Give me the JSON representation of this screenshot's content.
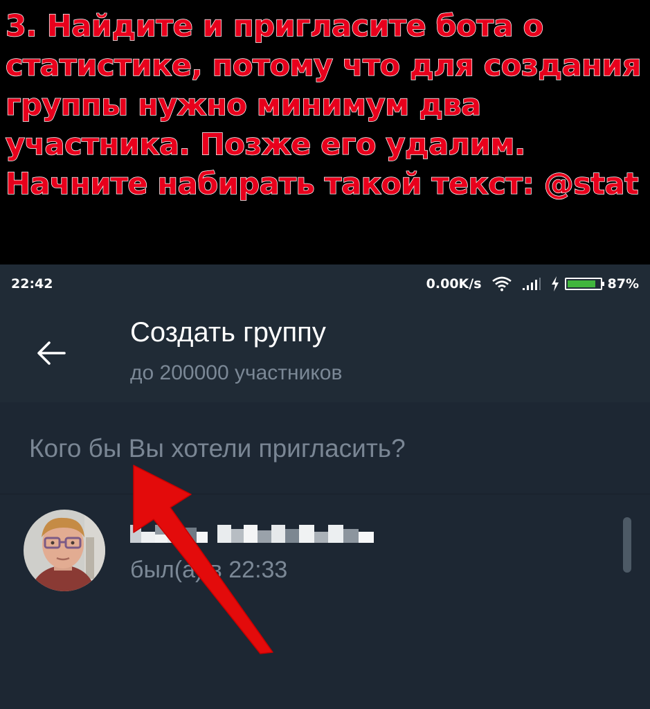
{
  "banner": {
    "text": "3. Найдите и пригласите бота о статистике, потому что для создания группы нужно минимум два участника. Позже его удалим. Начните набирать такой текст: @stat"
  },
  "status_bar": {
    "time": "22:42",
    "net_speed": "0.00K/s",
    "battery_percent": "87%",
    "battery_level": 0.87
  },
  "header": {
    "title": "Создать группу",
    "subtitle": "до 200000 участников",
    "back_icon": "arrow-left-icon"
  },
  "search": {
    "placeholder": "Кого бы Вы хотели пригласить?",
    "value": ""
  },
  "contacts": [
    {
      "name": "",
      "status": "был(а) в 22:33"
    }
  ],
  "colors": {
    "banner_text": "#e8001c",
    "screen_bg": "#1d2733",
    "header_bg": "#202b36",
    "secondary_text": "#7b8896",
    "annotation_arrow": "#e00000",
    "battery": "#41b53d"
  }
}
